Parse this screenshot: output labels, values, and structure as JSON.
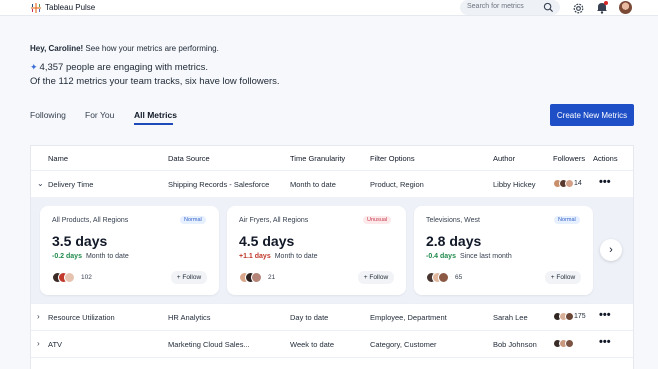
{
  "app": {
    "brand": "Tableau Pulse"
  },
  "search": {
    "placeholder": "Search for metrics"
  },
  "intro": {
    "greeting_bold": "Hey, Caroline!",
    "greeting_rest": " See how your metrics are performing.",
    "engagement": "4,357 people are engaging with metrics.",
    "summary": "Of the 112 metrics your team tracks, six have low followers."
  },
  "tabs": [
    {
      "label": "Following"
    },
    {
      "label": "For You"
    },
    {
      "label": "All Metrics",
      "active": true
    }
  ],
  "create_button": "Create New Metrics",
  "table": {
    "headers": [
      "Name",
      "Data Source",
      "Time Granularity",
      "Filter Options",
      "Author",
      "Followers",
      "Actions"
    ],
    "rows": [
      {
        "name": "Delivery Time",
        "source": "Shipping Records - Salesforce",
        "granularity": "Month to date",
        "filters": "Product, Region",
        "author": "Libby Hickey",
        "followers": "14",
        "actions": "•••"
      },
      {
        "name": "Resource Utilization",
        "source": "HR Analytics",
        "granularity": "Day to date",
        "filters": "Employee, Department",
        "author": "Sarah Lee",
        "followers": "175",
        "actions": "•••"
      },
      {
        "name": "ATV",
        "source": "Marketing Cloud Sales...",
        "granularity": "Week to date",
        "filters": "Category, Customer",
        "author": "Bob Johnson",
        "followers": "",
        "actions": "•••"
      }
    ]
  },
  "cards": [
    {
      "title": "All Products, All Regions",
      "badge": "Normal",
      "value": "3.5 days",
      "delta": "-0.2 days",
      "delta_text": "Month to date",
      "followers": "102",
      "follow": "+ Follow"
    },
    {
      "title": "Air Fryers, All Regions",
      "badge": "Unusual",
      "value": "4.5 days",
      "delta": "+1.1 days",
      "delta_text": "Month to date",
      "followers": "21",
      "follow": "+ Follow"
    },
    {
      "title": "Televisions, West",
      "badge": "Normal",
      "value": "2.8 days",
      "delta": "-0.4 days",
      "delta_text": "Since last month",
      "followers": "65",
      "follow": "+ Follow"
    }
  ],
  "colors": {
    "accent": "#1f4fc6",
    "positive": "#1f8a4c",
    "negative": "#c0392b"
  },
  "icons": [
    "tableau-logo-icon",
    "search-icon",
    "gear-icon",
    "bell-icon",
    "chevron-down-icon",
    "chevron-right-icon",
    "more-icon",
    "sparkle-icon"
  ]
}
